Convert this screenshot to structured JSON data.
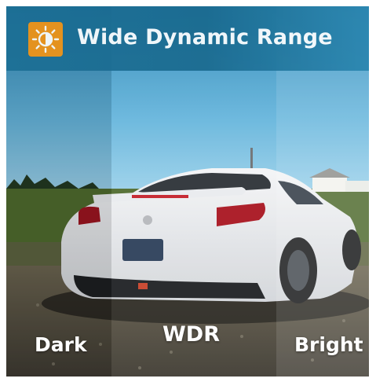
{
  "header": {
    "title": "Wide Dynamic Range",
    "icon": "sun-brightness-icon",
    "badge_color": "#f39414"
  },
  "panels": {
    "left_label": "Dark",
    "center_label": "WDR",
    "right_label": "Bright"
  }
}
